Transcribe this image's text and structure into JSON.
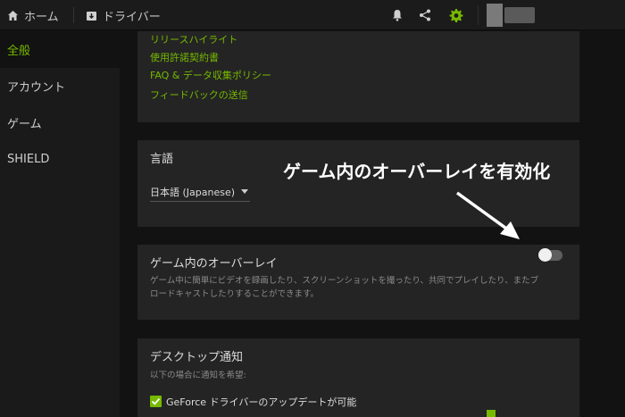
{
  "topbar": {
    "home_label": "ホーム",
    "driver_label": "ドライバー",
    "icons": [
      "home-icon",
      "driver-icon",
      "bell-icon",
      "share-icon",
      "gear-icon"
    ]
  },
  "sidebar": {
    "items": [
      {
        "label": "全般",
        "active": true
      },
      {
        "label": "アカウント",
        "active": false
      },
      {
        "label": "ゲーム",
        "active": false
      },
      {
        "label": "SHIELD",
        "active": false
      }
    ]
  },
  "about": {
    "links": [
      "リリースハイライト",
      "使用許諾契約書",
      "FAQ & データ収集ポリシー",
      "フィードバックの送信"
    ]
  },
  "language": {
    "title": "言語",
    "selected": "日本語 (Japanese)"
  },
  "overlay": {
    "title": "ゲーム内のオーバーレイ",
    "description": "ゲーム中に簡単にビデオを録画したり、スクリーンショットを撮ったり、共同でプレイしたり、またブロードキャストしたりすることができます。",
    "enabled": false
  },
  "notifications": {
    "title": "デスクトップ通知",
    "subtitle": "以下の場合に通知を希望:",
    "option_label": "GeForce ドライバーのアップデートが可能",
    "option_checked": true
  },
  "annotation": {
    "text": "ゲーム内のオーバーレイを有効化"
  },
  "colors": {
    "accent": "#76b900",
    "card": "#242424",
    "background": "#121212"
  }
}
